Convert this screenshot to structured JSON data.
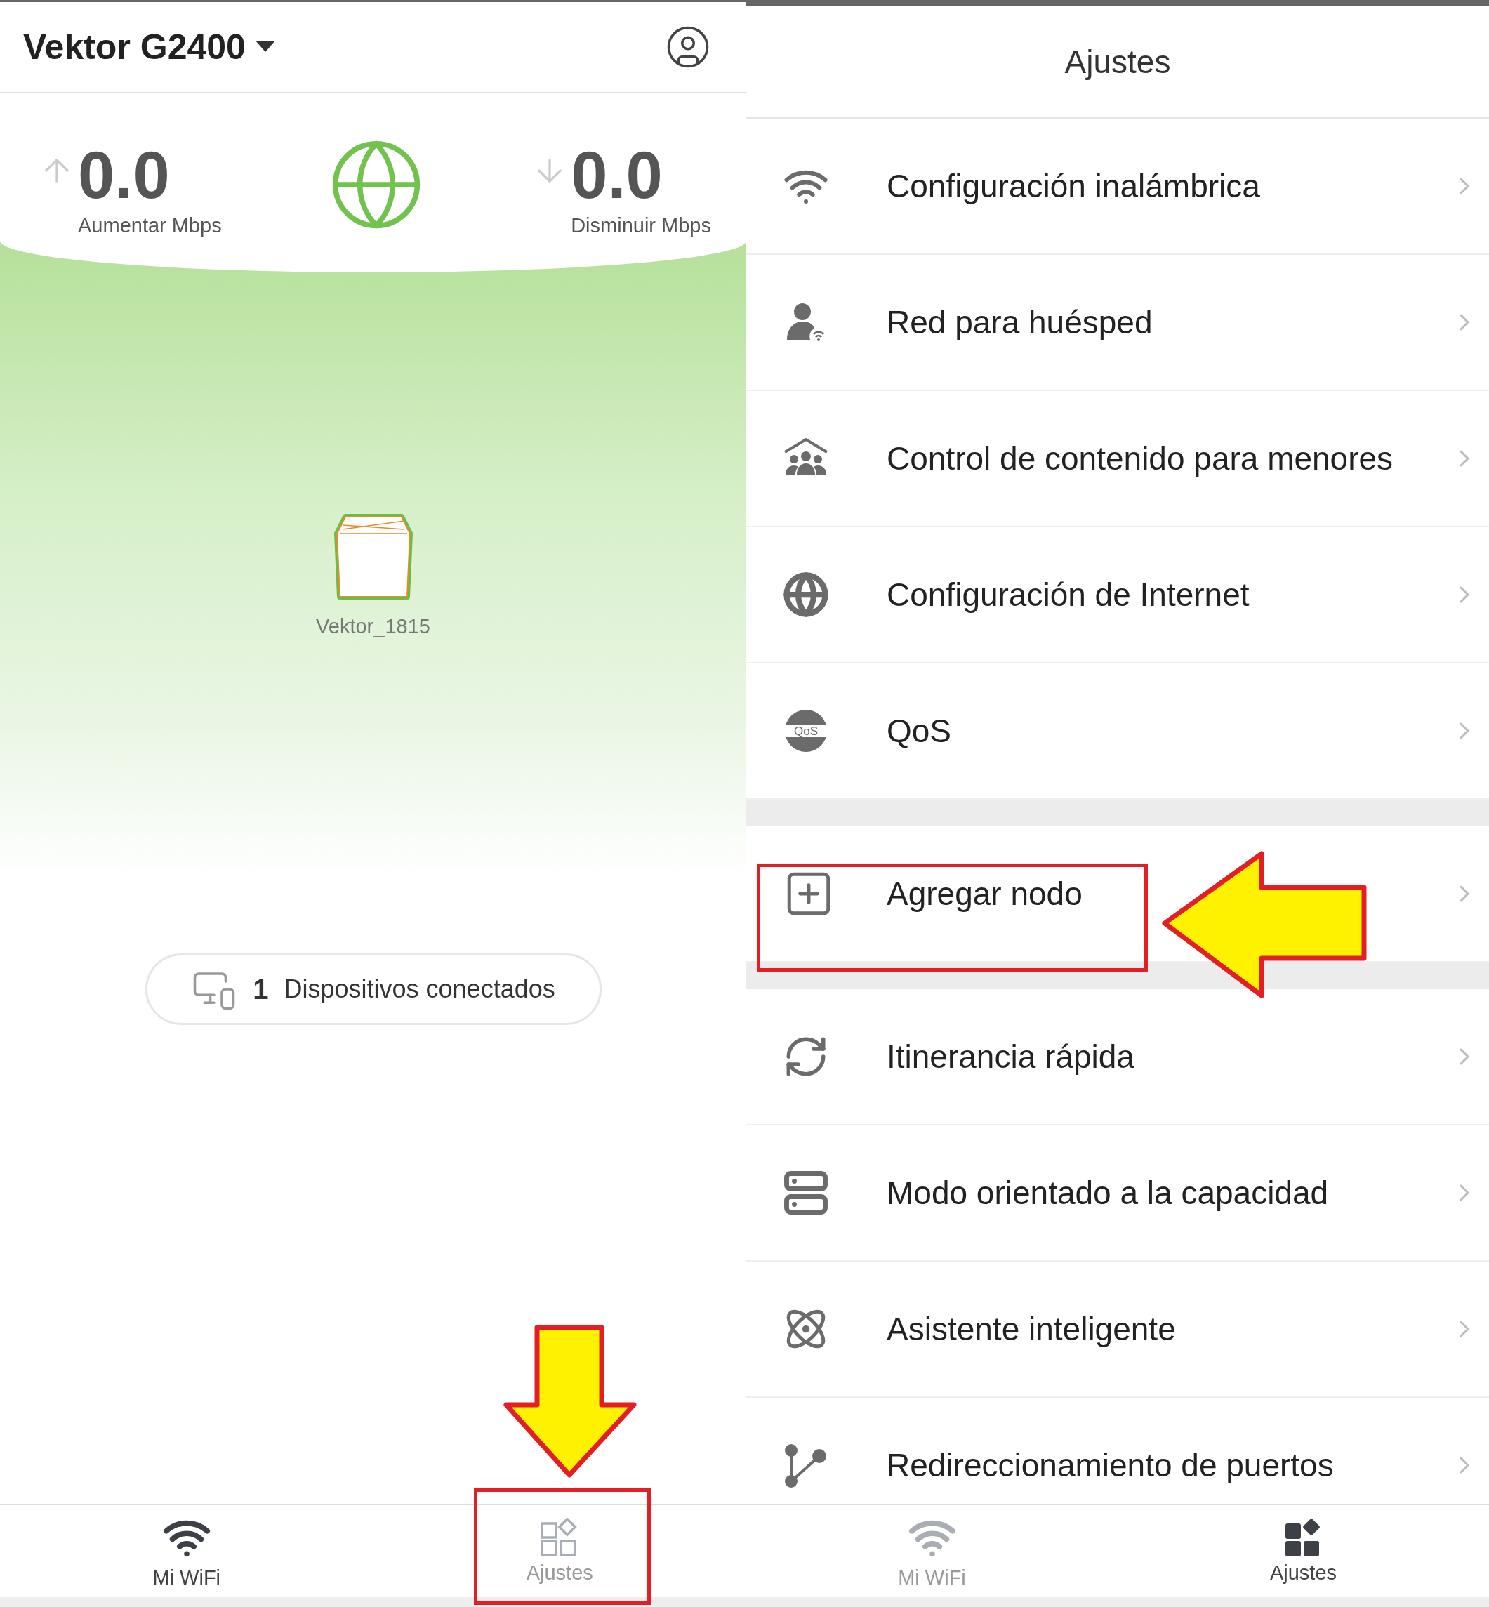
{
  "left": {
    "header": {
      "title": "Vektor G2400"
    },
    "upload": {
      "value": "0.0",
      "label": "Aumentar Mbps"
    },
    "download": {
      "value": "0.0",
      "label": "Disminuir Mbps"
    },
    "node": {
      "name": "Vektor_1815"
    },
    "devices": {
      "count": "1",
      "label": "Dispositivos conectados"
    },
    "nav": [
      {
        "label": "Mi WiFi",
        "kind": "wifi",
        "selected": true
      },
      {
        "label": "Ajustes",
        "kind": "settings",
        "selected": false
      }
    ]
  },
  "right": {
    "title": "Ajustes",
    "groups": [
      {
        "items": [
          {
            "label": "Configuración inalámbrica",
            "kind": "wifi"
          },
          {
            "label": "Red para huésped",
            "kind": "guest"
          },
          {
            "label": "Control de contenido para menores",
            "kind": "family"
          },
          {
            "label": "Configuración de Internet",
            "kind": "globe"
          },
          {
            "label": "QoS",
            "kind": "qos",
            "icon_text": "QoS"
          }
        ]
      },
      {
        "items": [
          {
            "label": "Agregar nodo",
            "kind": "add"
          }
        ]
      },
      {
        "items": [
          {
            "label": "Itinerancia rápida",
            "kind": "roam"
          },
          {
            "label": "Modo orientado a la capacidad",
            "kind": "server"
          },
          {
            "label": "Asistente inteligente",
            "kind": "atom"
          },
          {
            "label": "Redireccionamiento de puertos",
            "kind": "ports"
          }
        ]
      }
    ],
    "nav": [
      {
        "label": "Mi WiFi",
        "kind": "wifi",
        "selected": false
      },
      {
        "label": "Ajustes",
        "kind": "settings",
        "selected": true
      }
    ]
  }
}
